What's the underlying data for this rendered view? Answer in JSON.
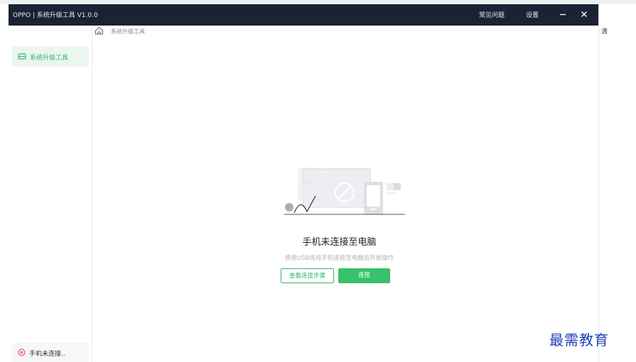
{
  "window": {
    "title": "OPPO | 系统升级工具  V1.0.0",
    "menu": {
      "faq": "常见问题",
      "settings": "设置"
    }
  },
  "sidebar": {
    "items": [
      {
        "label": "系统升级工具",
        "icon": "drive-icon",
        "active": true
      }
    ],
    "status": {
      "label": "手机未连接..",
      "icon": "error-circle-icon"
    }
  },
  "breadcrumb": {
    "label": "系统升级工具",
    "icon": "home-icon"
  },
  "empty_state": {
    "title": "手机未连接至电脑",
    "description": "使用USB线将手机连接至电脑后开始操作",
    "secondary_button": "查看连接步骤",
    "primary_button": "连接"
  },
  "background": {
    "side_char": "清"
  },
  "watermark": "最需教育",
  "colors": {
    "accent": "#35b36a",
    "primary_button": "#37c16a",
    "titlebar": "#1a2233",
    "error": "#e0454a"
  }
}
